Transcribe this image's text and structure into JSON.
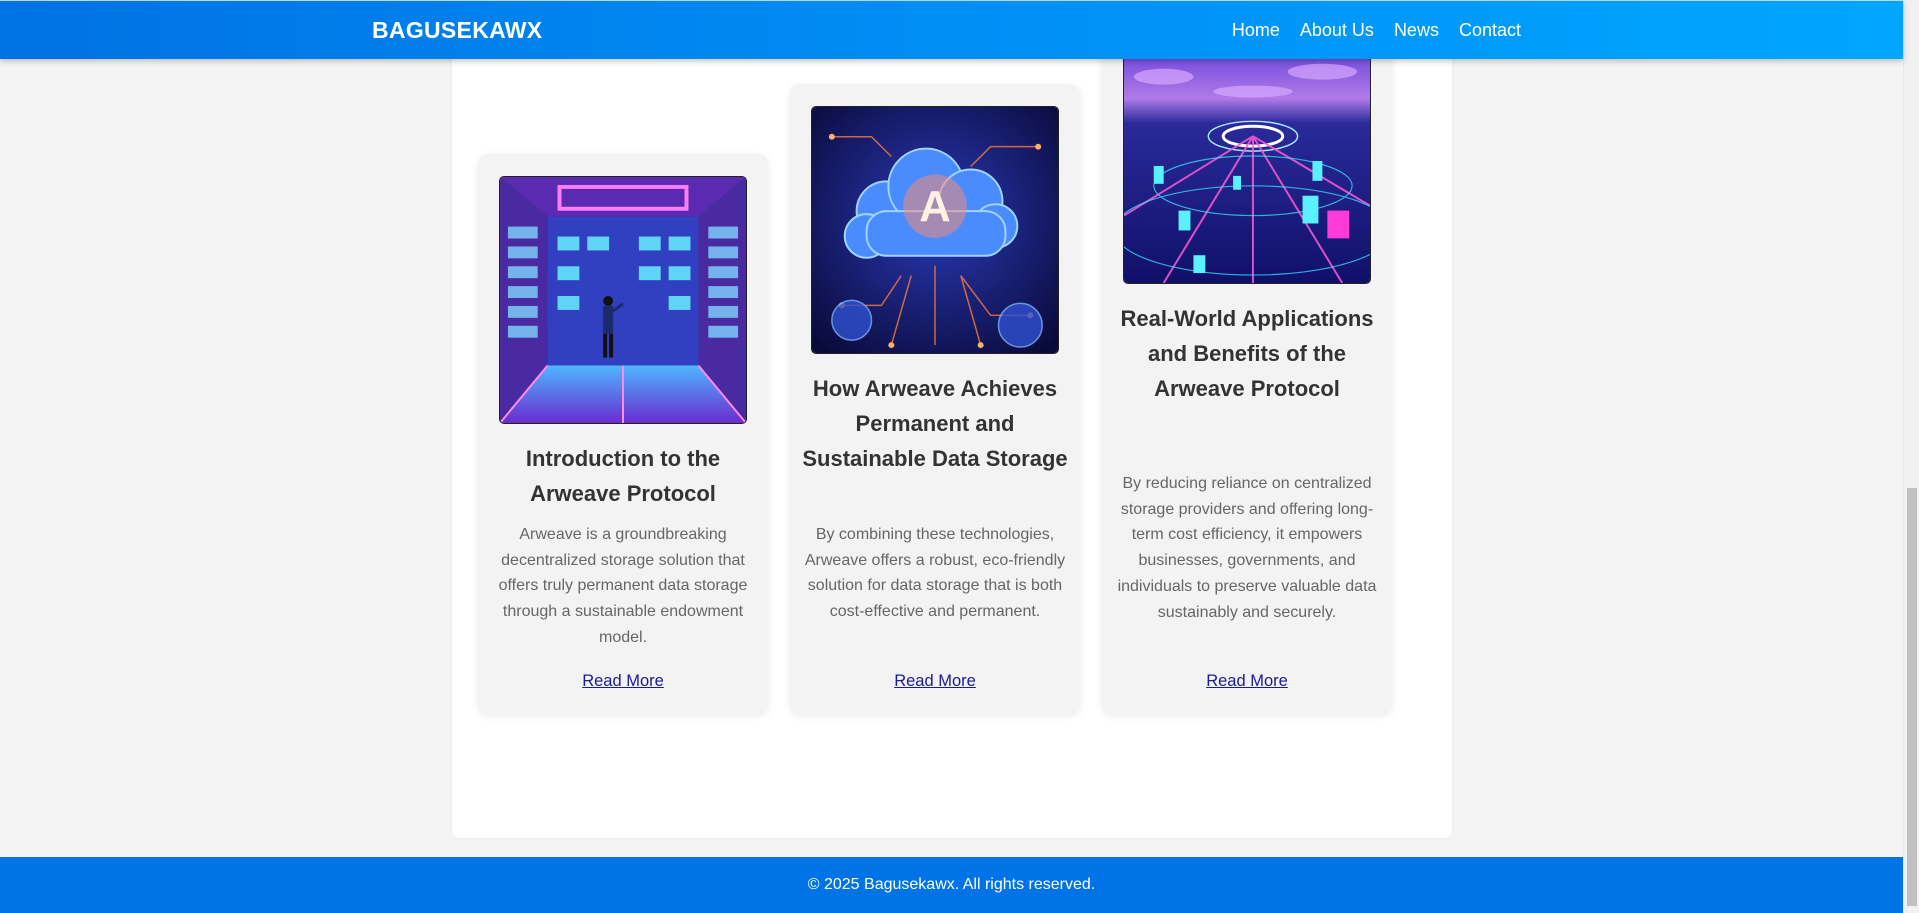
{
  "header": {
    "brand": "BAGUSEKAWX",
    "nav": [
      "Home",
      "About Us",
      "News",
      "Contact"
    ]
  },
  "cards": [
    {
      "title": "Introduction to the Arweave Protocol",
      "description": "Arweave is a groundbreaking decentralized storage solution that offers truly permanent data storage through a sustainable endowment model.",
      "link": "Read More"
    },
    {
      "title": "How Arweave Achieves Permanent and Sustainable Data Storage",
      "description": "By combining these technologies, Arweave offers a robust, eco-friendly solution for data storage that is both cost-effective and permanent.",
      "link": "Read More"
    },
    {
      "title": "Real-World Applications and Benefits of the Arweave Protocol",
      "description": "By reducing reliance on centralized storage providers and offering long-term cost efficiency, it empowers businesses, governments, and individuals to preserve valuable data sustainably and securely.",
      "link": "Read More"
    }
  ],
  "footer": {
    "copyright": "© 2025 Bagusekawx. All rights reserved."
  },
  "colors": {
    "header": "#0080ee",
    "footer": "#0073e6",
    "link": "#1a1a9e"
  }
}
